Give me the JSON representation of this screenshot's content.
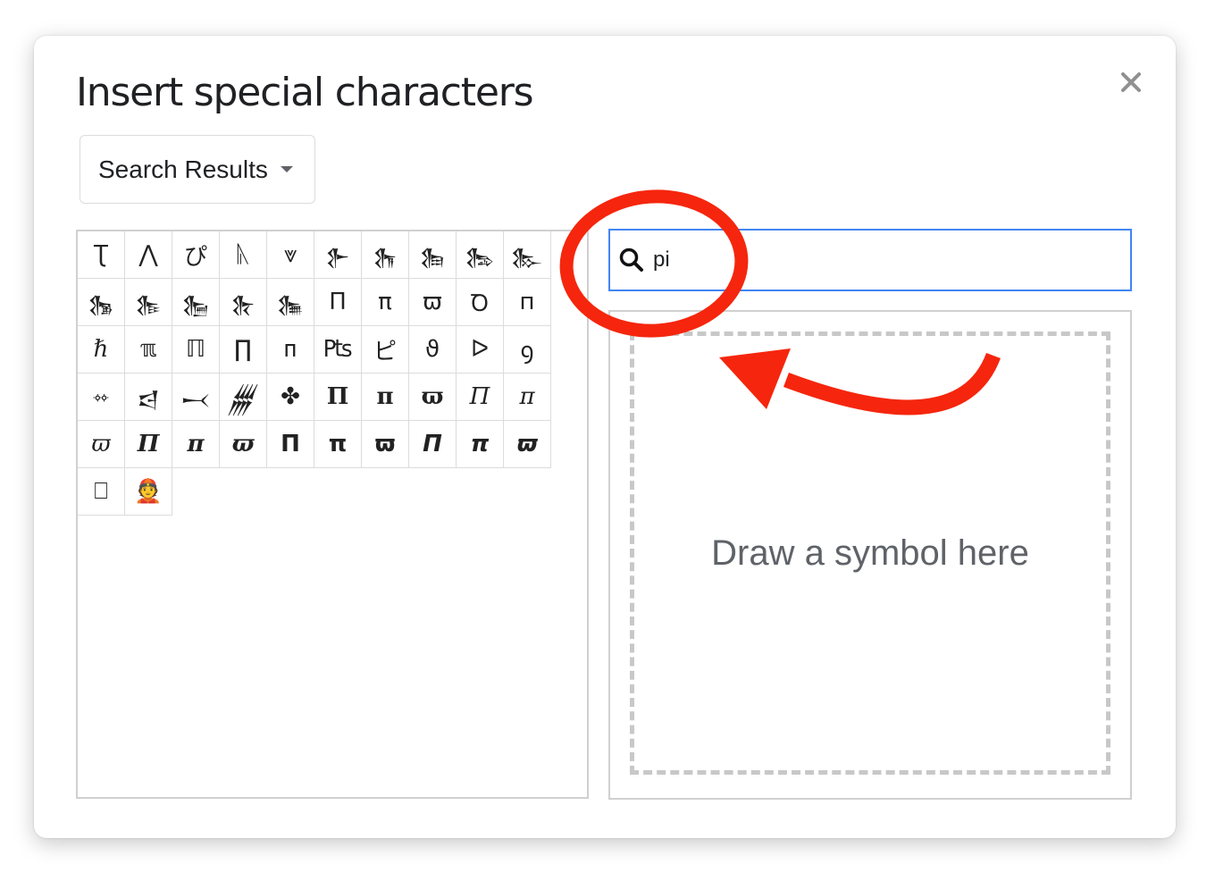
{
  "dialog": {
    "title": "Insert special characters",
    "close_icon": "close-icon"
  },
  "category_dropdown": {
    "selected": "Search Results",
    "icon": "caret-down-icon"
  },
  "search": {
    "icon": "search-icon",
    "value": "pi",
    "accent_color": "#4285f4"
  },
  "draw_area": {
    "hint": "Draw a symbol here"
  },
  "characters": [
    {
      "char": "Ʈ",
      "style": "sans"
    },
    {
      "char": "⋀",
      "style": "sans"
    },
    {
      "char": "ぴ",
      "style": "sans"
    },
    {
      "char": "ᚣ",
      "style": "sans"
    },
    {
      "char": "⩔",
      "style": "sans"
    },
    {
      "char": "𒉿",
      "style": "sans"
    },
    {
      "char": "𒊀",
      "style": "sans"
    },
    {
      "char": "𒊁",
      "style": "sans"
    },
    {
      "char": "𒊂",
      "style": "sans"
    },
    {
      "char": "𒊃",
      "style": "sans"
    },
    {
      "char": "𒊄",
      "style": "sans"
    },
    {
      "char": "𒊅",
      "style": "sans"
    },
    {
      "char": "𒊆",
      "style": "sans"
    },
    {
      "char": "𒊇",
      "style": "sans"
    },
    {
      "char": "𒊈",
      "style": "sans"
    },
    {
      "char": "Π",
      "style": "sans"
    },
    {
      "char": "π",
      "style": "sans"
    },
    {
      "char": "ϖ",
      "style": "sans"
    },
    {
      "char": "Ꝺ",
      "style": "sans"
    },
    {
      "char": "п",
      "style": "sans"
    },
    {
      "char": "ℏ",
      "style": "italic"
    },
    {
      "char": "ℼ",
      "style": "sans"
    },
    {
      "char": "ℿ",
      "style": "sans"
    },
    {
      "char": "∏",
      "style": "sans"
    },
    {
      "char": "ᴨ",
      "style": "sans"
    },
    {
      "char": "₧",
      "style": "sans"
    },
    {
      "char": "ピ",
      "style": "sans"
    },
    {
      "char": "ϑ",
      "style": "sans"
    },
    {
      "char": "ᐅ",
      "style": "sans"
    },
    {
      "char": "ꝯ",
      "style": "sans"
    },
    {
      "char": "𐄣",
      "style": "sans"
    },
    {
      "char": "𒁀",
      "style": "sans"
    },
    {
      "char": "𒁁",
      "style": "sans"
    },
    {
      "char": "𒁂",
      "style": "sans"
    },
    {
      "char": "✤",
      "style": "sans"
    },
    {
      "char": "𝚷",
      "style": "bold"
    },
    {
      "char": "𝛑",
      "style": "bold"
    },
    {
      "char": "𝛡",
      "style": "bold"
    },
    {
      "char": "𝛱",
      "style": "italic"
    },
    {
      "char": "𝜋",
      "style": "italic"
    },
    {
      "char": "𝜛",
      "style": "italic"
    },
    {
      "char": "𝜫",
      "style": "bold italic"
    },
    {
      "char": "𝝅",
      "style": "bold italic"
    },
    {
      "char": "𝝕",
      "style": "bold italic"
    },
    {
      "char": "𝝥",
      "style": "sans bold"
    },
    {
      "char": "𝝿",
      "style": "sans bold"
    },
    {
      "char": "𝞏",
      "style": "sans bold"
    },
    {
      "char": "𝞟",
      "style": "sans bold italic"
    },
    {
      "char": "𝞹",
      "style": "sans bold italic"
    },
    {
      "char": "𝟉",
      "style": "sans bold italic"
    },
    {
      "char": "⎕",
      "style": "sans"
    },
    {
      "char": "👲",
      "style": "sans"
    }
  ],
  "annotation": {
    "color": "#f5260d",
    "circle_target": "search-box",
    "arrow_direction": "pointing from draw area toward search"
  }
}
